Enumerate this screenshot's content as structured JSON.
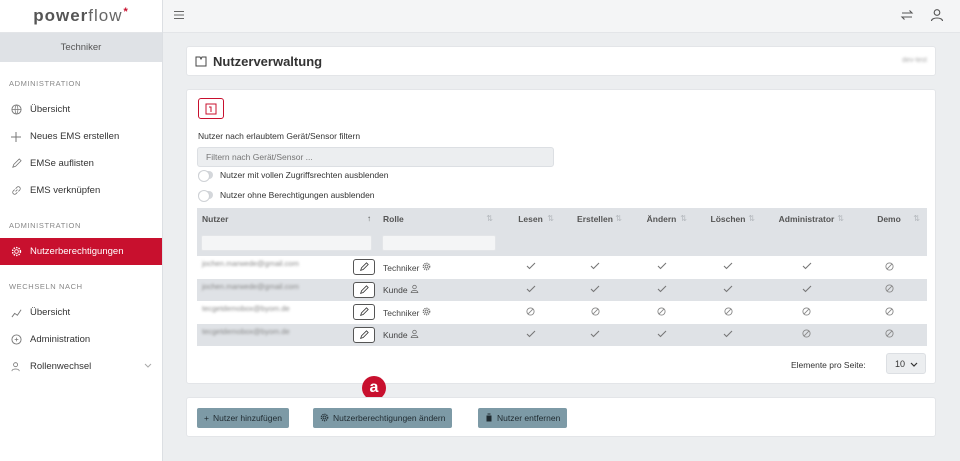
{
  "app": {
    "logo_main": "power",
    "logo_light": "flow",
    "logo_star": "*",
    "current_role": "Techniker"
  },
  "sidebar": {
    "section1": "ADMINISTRATION",
    "items1": [
      {
        "label": "Übersicht",
        "icon": "globe-icon"
      },
      {
        "label": "Neues EMS erstellen",
        "icon": "plus-icon"
      },
      {
        "label": "EMSe auflisten",
        "icon": "pencil-icon"
      },
      {
        "label": "EMS verknüpfen",
        "icon": "link-icon"
      }
    ],
    "section2": "ADMINISTRATION",
    "items2": [
      {
        "label": "Nutzerberechtigungen",
        "icon": "gear-icon",
        "active": true
      }
    ],
    "section3": "WECHSELN NACH",
    "items3": [
      {
        "label": "Übersicht",
        "icon": "chart-icon"
      },
      {
        "label": "Administration",
        "icon": "admin-icon"
      },
      {
        "label": "Rollenwechsel",
        "icon": "users-icon"
      }
    ]
  },
  "page": {
    "title": "Nutzerverwaltung",
    "env": "dev-test"
  },
  "filter": {
    "label": "Nutzer nach erlaubtem Gerät/Sensor filtern",
    "placeholder": "Filtern nach Gerät/Sensor ...",
    "toggle1": "Nutzer mit vollen Zugriffsrechten ausblenden",
    "toggle2": "Nutzer ohne Berechtigungen ausblenden"
  },
  "table": {
    "headers": {
      "user": "Nutzer",
      "role": "Rolle",
      "read": "Lesen",
      "create": "Erstellen",
      "change": "Ändern",
      "delete": "Löschen",
      "admin": "Administrator",
      "demo": "Demo"
    },
    "rows": [
      {
        "email": "jochen.marwede@gmail.com",
        "role": "Techniker",
        "role_icon": "gear-icon",
        "perms": [
          "check",
          "check",
          "check",
          "check",
          "check",
          "none"
        ]
      },
      {
        "email": "jochen.marwede@gmail.com",
        "role": "Kunde",
        "role_icon": "user-icon",
        "perms": [
          "check",
          "check",
          "check",
          "check",
          "check",
          "none"
        ]
      },
      {
        "email": "tecgetdemobox@byom.de",
        "role": "Techniker",
        "role_icon": "gear-icon",
        "perms": [
          "none",
          "none",
          "none",
          "none",
          "none",
          "none"
        ]
      },
      {
        "email": "tecgetdemobox@byom.de",
        "role": "Kunde",
        "role_icon": "user-icon",
        "perms": [
          "check",
          "check",
          "check",
          "check",
          "none",
          "none"
        ]
      }
    ]
  },
  "pagination": {
    "label": "Elemente pro Seite:",
    "value": "10"
  },
  "actions": {
    "add": "Nutzer hinzufügen",
    "change": "Nutzerberechtigungen ändern",
    "remove": "Nutzer entfernen"
  },
  "annotation": {
    "badge": "a"
  },
  "colors": {
    "accent": "#c8102e",
    "button": "#7d9aa6"
  }
}
